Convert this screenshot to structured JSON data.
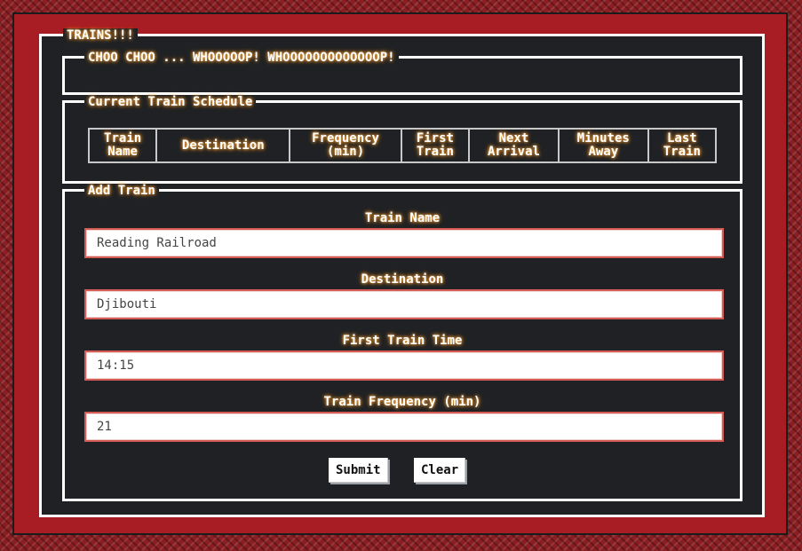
{
  "app": {
    "title": "TRAINS!!!"
  },
  "header": {
    "text": "CHOO CHOO ... WHOOOOOP! WHOOOOOOOOOOOOOP!"
  },
  "schedule": {
    "title": "Current Train Schedule",
    "columns": [
      "Train\nName",
      "Destination",
      "Frequency\n(min)",
      "First\nTrain",
      "Next\nArrival",
      "Minutes\nAway",
      "Last\nTrain"
    ],
    "rows": []
  },
  "add_train": {
    "title": "Add Train",
    "fields": [
      {
        "label": "Train Name",
        "value": "Reading Railroad"
      },
      {
        "label": "Destination",
        "value": "Djibouti"
      },
      {
        "label": "First Train Time",
        "value": "14:15"
      },
      {
        "label": "Train Frequency (min)",
        "value": "21"
      }
    ],
    "submit_label": "Submit",
    "clear_label": "Clear"
  },
  "colors": {
    "page_background": "#8a1e22",
    "frame": "#a81c23",
    "panel": "#1f2124",
    "text_glow": "#ff8a1a",
    "input_border": "#d45c54"
  }
}
